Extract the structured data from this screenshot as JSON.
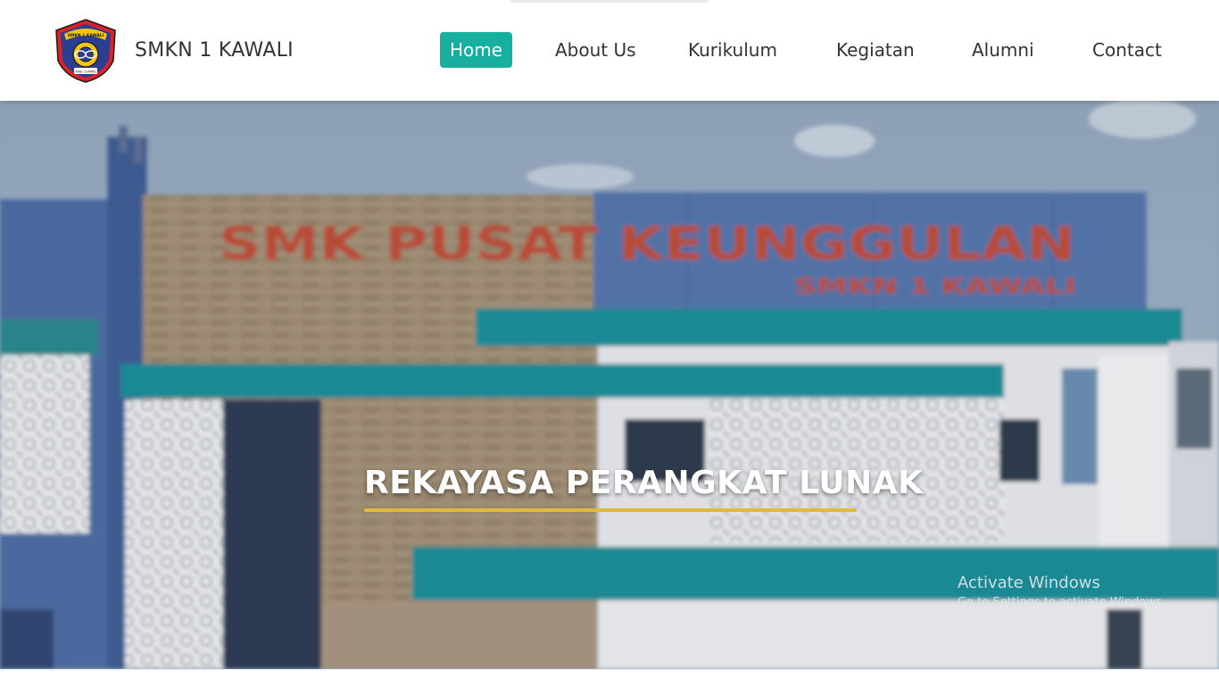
{
  "header": {
    "brand": "SMKN 1 KAWALI",
    "logo": {
      "icon": "school-shield-logo",
      "text_top": "SMKN 1 KAWALI",
      "text_bottom": "KAB. CIAMIS",
      "colors": {
        "outer": "#d8232a",
        "inner": "#2c3e92",
        "accent": "#f2c418"
      }
    }
  },
  "nav": {
    "active_color": "#17b0a0",
    "items": [
      {
        "label": "Home",
        "active": true
      },
      {
        "label": "About Us",
        "active": false
      },
      {
        "label": "Kurikulum",
        "active": false
      },
      {
        "label": "Kegiatan",
        "active": false
      },
      {
        "label": "Alumni",
        "active": false
      },
      {
        "label": "Contact",
        "active": false
      }
    ]
  },
  "hero": {
    "title": "REKAYASA PERANGKAT LUNAK",
    "underline_color": "#e2b93b",
    "building_sign_main": "SMK PUSAT KEUNGGULAN",
    "building_sign_sub": "SMKN 1 KAWALI"
  },
  "watermark": {
    "title": "Activate Windows",
    "subtitle": "Go to Settings to activate Windows."
  }
}
